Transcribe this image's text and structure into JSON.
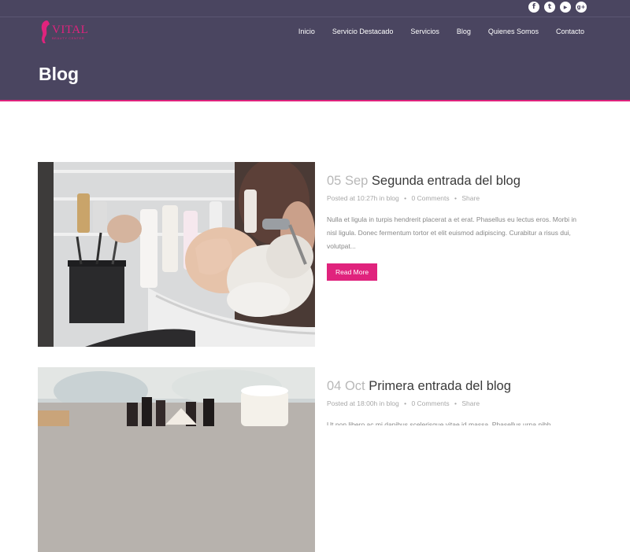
{
  "brand": {
    "name": "VITAL",
    "tagline": "BEAUTY CENTER",
    "accent": "#e0237d",
    "header_bg": "#4a4560"
  },
  "social": [
    {
      "icon": "facebook-icon",
      "glyph": "f"
    },
    {
      "icon": "twitter-icon",
      "glyph": "t"
    },
    {
      "icon": "youtube-icon",
      "glyph": "▶"
    },
    {
      "icon": "google-plus-icon",
      "glyph": "g+"
    }
  ],
  "nav": {
    "items": [
      "Inicio",
      "Servicio Destacado",
      "Servicios",
      "Blog",
      "Quienes Somos",
      "Contacto"
    ]
  },
  "page": {
    "title": "Blog"
  },
  "posts": [
    {
      "day": "05",
      "month": "Sep",
      "title": "Segunda entrada del blog",
      "meta_posted": "Posted at 10:27h in",
      "meta_category": "blog",
      "meta_comments": "0 Comments",
      "meta_share": "Share",
      "excerpt": "Nulla et ligula in turpis hendrerit placerat a et erat. Phasellus eu lectus eros. Morbi in nisl ligula. Donec fermentum tortor et elit euismod adipiscing. Curabitur a risus dui, volutpat...",
      "button": "Read More"
    },
    {
      "day": "04",
      "month": "Oct",
      "title": "Primera entrada del blog",
      "meta_posted": "Posted at 18:00h in",
      "meta_category": "blog",
      "meta_comments": "0 Comments",
      "meta_share": "Share",
      "excerpt": "Ut non libero ac mi dapibus scelerisque vitae id massa. Phasellus urna nibh"
    }
  ]
}
